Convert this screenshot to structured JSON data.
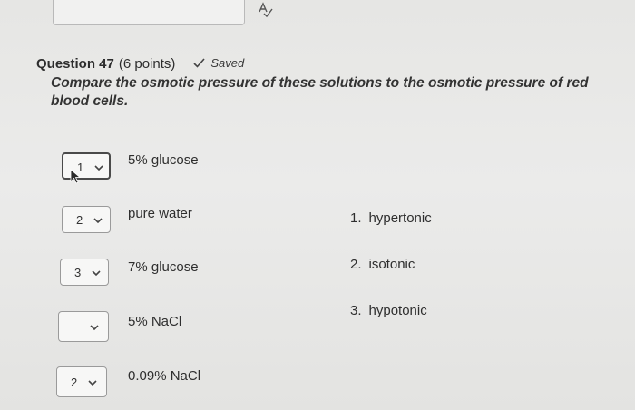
{
  "question": {
    "title": "Question 47",
    "points": "(6 points)",
    "saved_label": "Saved",
    "prompt": "Compare the osmotic pressure of these solutions to the osmotic pressure of red blood cells."
  },
  "matching_items": [
    {
      "selected": "1",
      "label": "5% glucose"
    },
    {
      "selected": "2",
      "label": "pure water"
    },
    {
      "selected": "3",
      "label": "7% glucose"
    },
    {
      "selected": "",
      "label": "5% NaCl"
    },
    {
      "selected": "2",
      "label": "0.09% NaCl"
    }
  ],
  "choices": [
    {
      "num": "1.",
      "label": "hypertonic"
    },
    {
      "num": "2.",
      "label": "isotonic"
    },
    {
      "num": "3.",
      "label": "hypotonic"
    }
  ],
  "icons": {
    "spell_check": "spell-check-icon",
    "saved_check": "checkmark-icon",
    "dropdown": "chevron-down-icon",
    "cursor": "mouse-pointer-icon"
  }
}
